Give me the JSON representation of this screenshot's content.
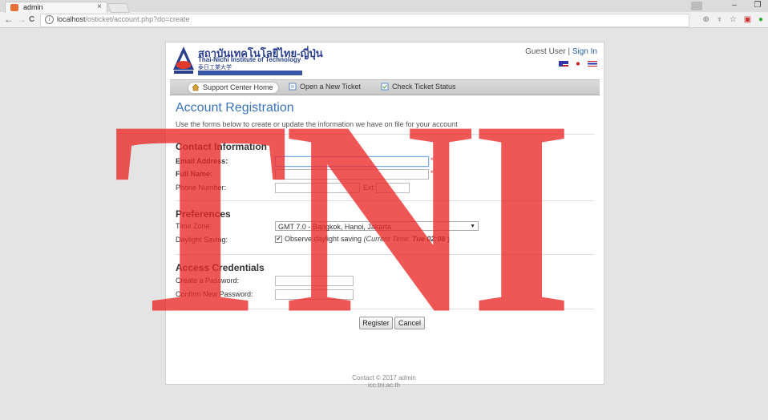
{
  "browser": {
    "tab_title": "admin",
    "tab_close": "×",
    "url_host": "localhost",
    "url_path": "/osticket/account.php?do=create",
    "info_icon_text": "i",
    "win_min": "–",
    "win_restore": "❐",
    "back": "←",
    "forward": "→",
    "reload": "C"
  },
  "header": {
    "brand_thai": "สถาบันเทคโนโลยีไทย-ญี่ปุ่น",
    "brand_english": "Thai-Nichi Institute of Technology",
    "brand_japanese": "泰日工業大学",
    "guest_label": "Guest User",
    "separator": "|",
    "sign_in": "Sign In"
  },
  "nav": {
    "items": [
      {
        "label": "Support Center Home",
        "active": true
      },
      {
        "label": "Open a New Ticket",
        "active": false
      },
      {
        "label": "Check Ticket Status",
        "active": false
      }
    ]
  },
  "page": {
    "title": "Account Registration",
    "intro": "Use the forms below to create or update the information we have on file for your account"
  },
  "contact": {
    "heading": "Contact Information",
    "email_label": "Email Address:",
    "full_name_label": "Full Name:",
    "phone_label": "Phone Number:",
    "ext_label": "Ext:",
    "required_mark": "*"
  },
  "preferences": {
    "heading": "Preferences",
    "timezone_label": "Time Zone:",
    "timezone_value": "GMT 7.0 - Bangkok, Hanoi, Jakarta",
    "daylight_label": "Daylight Saving:",
    "daylight_checked": true,
    "daylight_option": "Observe daylight saving",
    "current_time_prefix": "(Current Time:",
    "current_time": "Tue 02:08",
    "current_time_suffix": ")"
  },
  "credentials": {
    "heading": "Access Credentials",
    "create_password_label": "Create a Password:",
    "confirm_password_label": "Confirm New Password:"
  },
  "actions": {
    "register": "Register",
    "cancel": "Cancel"
  },
  "footer": {
    "line1": "Contact © 2017 admin",
    "line2": "icc.tni.ac.th"
  },
  "watermark": {
    "text": "TNI",
    "color": "#eb2828"
  },
  "colors": {
    "title_blue": "#3a73b8",
    "link_blue": "#2a5db0",
    "required_red": "#dd3333",
    "brand_blue": "#2a3f8c"
  }
}
